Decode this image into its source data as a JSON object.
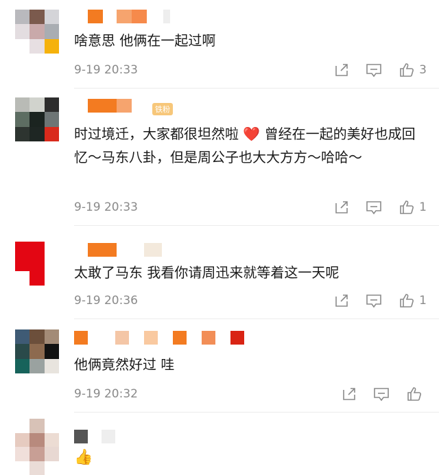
{
  "comments": [
    {
      "text": "啥意思 他俩在一起过啊",
      "time": "9-19 20:33",
      "likes": "3"
    },
    {
      "text": "时过境迁，大家都很坦然啦 ❤️ 曾经在一起的美好也成回忆～马东八卦，但是周公子也大大方方～哈哈～",
      "time": "9-19 20:33",
      "likes": "1",
      "badge": "铁粉"
    },
    {
      "text": "太敢了马东 我看你请周迅来就等着这一天呢",
      "time": "9-19 20:36",
      "likes": "1"
    },
    {
      "text": "他俩竟然好过 哇",
      "time": "9-19 20:32",
      "likes": ""
    },
    {
      "text": "👍",
      "time": "",
      "likes": ""
    }
  ]
}
